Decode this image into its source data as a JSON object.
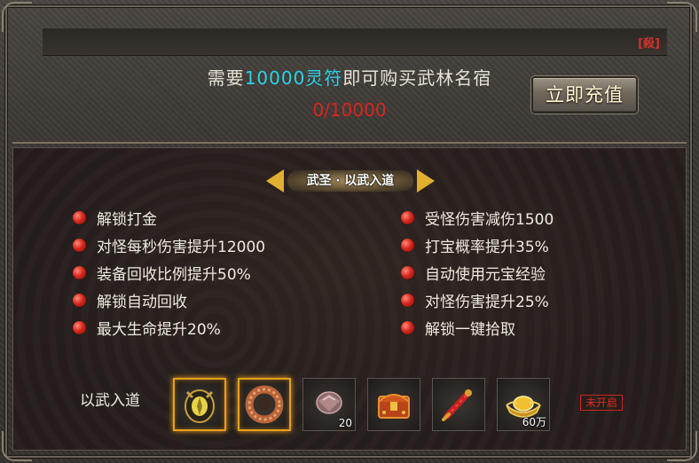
{
  "header": {
    "prefix": "需要",
    "amount": "10000灵符",
    "suffix": "即可购买武林名宿",
    "progress": "0/10000",
    "recharge_label": "立即充值",
    "close_label": "[殺]"
  },
  "panel": {
    "title": "武圣 · 以武入道",
    "left_attributes": [
      "解锁打金",
      "对怪每秒伤害提升12000",
      "装备回收比例提升50%",
      "解锁自动回收",
      "最大生命提升20%"
    ],
    "right_attributes": [
      "受怪伤害减伤1500",
      "打宝概率提升35%",
      "自动使用元宝经验",
      "对怪伤害提升25%",
      "解锁一键拾取"
    ]
  },
  "rewards": {
    "label": "以武入道",
    "items": [
      {
        "icon": "medal-icon",
        "qty": "",
        "highlight": true
      },
      {
        "icon": "ring-icon",
        "qty": "",
        "highlight": true
      },
      {
        "icon": "gem-icon",
        "qty": "20",
        "highlight": false
      },
      {
        "icon": "treasure-chest-icon",
        "qty": "",
        "highlight": false
      },
      {
        "icon": "scroll-icon",
        "qty": "",
        "highlight": false
      },
      {
        "icon": "gold-ingot-icon",
        "qty": "60万",
        "highlight": false
      }
    ],
    "status": "未开启"
  },
  "colors": {
    "highlight_cyan": "#2ad2e6",
    "progress_red": "#d8261e",
    "slot_gold": "#e3a020",
    "bullet_red": "#d6281e"
  }
}
